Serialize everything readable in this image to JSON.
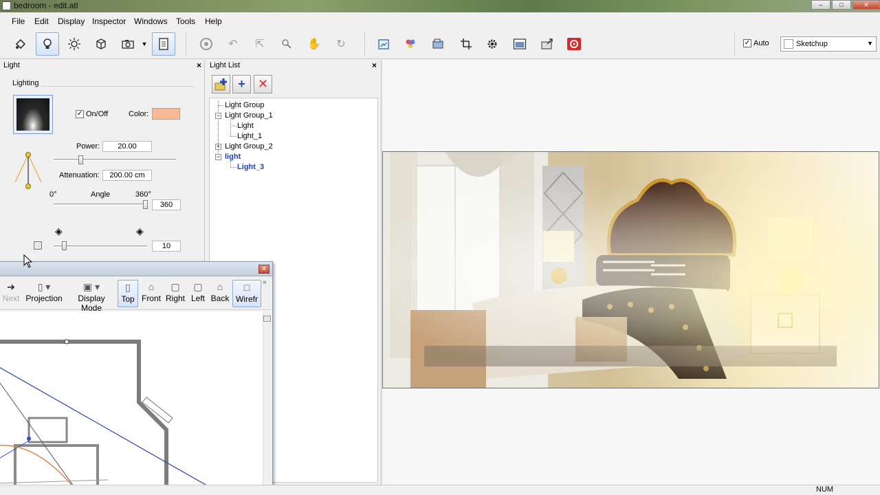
{
  "window": {
    "title": "bedroom - edit.atl"
  },
  "menu": [
    "File",
    "Edit",
    "Display",
    "Inspector",
    "Windows",
    "Tools",
    "Help"
  ],
  "toolbar": {
    "auto_checked": true,
    "auto_label": "Auto",
    "renderer_value": "Sketchup"
  },
  "light_panel": {
    "title": "Light",
    "group_label": "Lighting",
    "onoff_checked": true,
    "onoff_label": "On/Off",
    "color_label": "Color:",
    "color_value": "#f6b995",
    "power_label": "Power:",
    "power_value": "20.00",
    "power_slider_fraction": 0.2,
    "attenuation_label": "Attenuation:",
    "attenuation_value": "200.00 cm",
    "angle_min": "0°",
    "angle_label": "Angle",
    "angle_max": "360°",
    "angle_value": "360",
    "bottom_value": "10"
  },
  "light_list": {
    "title": "Light List",
    "tree": [
      {
        "label": "Light Group",
        "level": 0
      },
      {
        "label": "Light Group_1",
        "level": 0,
        "expanded": true
      },
      {
        "label": "Light",
        "level": 1
      },
      {
        "label": "Light_1",
        "level": 1
      },
      {
        "label": "Light Group_2",
        "level": 0,
        "expanded": false
      },
      {
        "label": "light",
        "level": 0,
        "expanded": true,
        "selected": true
      },
      {
        "label": "Light_3",
        "level": 1,
        "selected": true
      }
    ]
  },
  "view_toolbar": {
    "next_label": "Next",
    "projection_label": "Projection",
    "display_mode_label": "Display Mode",
    "top_label": "Top",
    "front_label": "Front",
    "right_label": "Right",
    "left_label": "Left",
    "back_label": "Back",
    "wireframe_label": "Wirefr"
  },
  "status": {
    "num": "NUM"
  },
  "colors": {
    "selection_blue": "#1f3fbf",
    "active_tool": "#d5e3f7",
    "color_swatch": "#f6b995"
  }
}
